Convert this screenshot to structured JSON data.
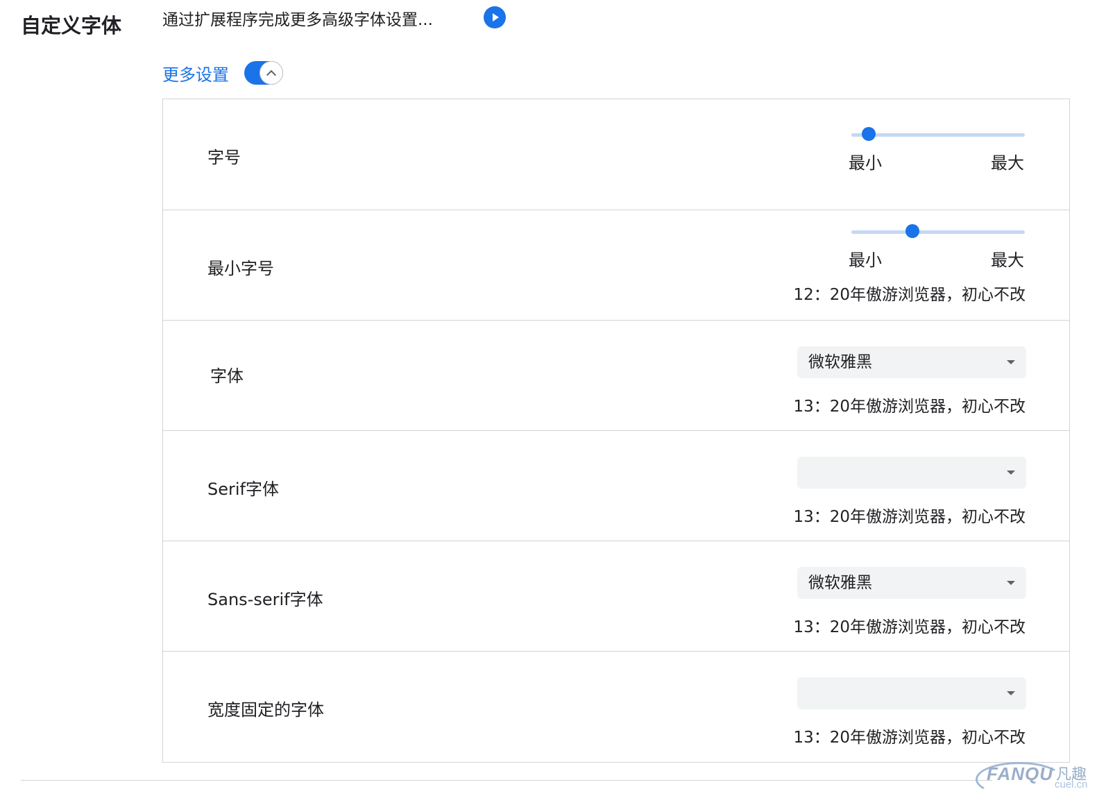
{
  "section": {
    "title": "自定义字体",
    "extension_link": "通过扩展程序完成更多高级字体设置...",
    "extension_icon": "play-circle-icon",
    "more_settings_label": "更多设置",
    "more_settings_expanded": true
  },
  "font_size": {
    "label": "字号",
    "slider_fraction": 0.1,
    "min_label": "最小",
    "max_label": "最大"
  },
  "min_font_size": {
    "label": "最小字号",
    "slider_fraction": 0.35,
    "min_label": "最小",
    "max_label": "最大",
    "sample": "12：20年傲游浏览器，初心不改"
  },
  "standard_font": {
    "label": "字体",
    "selected": "微软雅黑",
    "sample": "13：20年傲游浏览器，初心不改"
  },
  "serif_font": {
    "label": "Serif字体",
    "selected": "",
    "sample": "13：20年傲游浏览器，初心不改"
  },
  "sans_serif_font": {
    "label": "Sans-serif字体",
    "selected": "微软雅黑",
    "sample": "13：20年傲游浏览器，初心不改"
  },
  "fixed_width_font": {
    "label": "宽度固定的字体",
    "selected": "",
    "sample": "13：20年傲游浏览器，初心不改"
  },
  "watermark": {
    "brand": "FANQU",
    "chinese": "凡趣",
    "url": "cuel.cn"
  },
  "colors": {
    "accent": "#1a73e8",
    "slider_track": "#c5d8f3",
    "dropdown_bg": "#f1f3f4",
    "divider": "#d3d3d3"
  }
}
